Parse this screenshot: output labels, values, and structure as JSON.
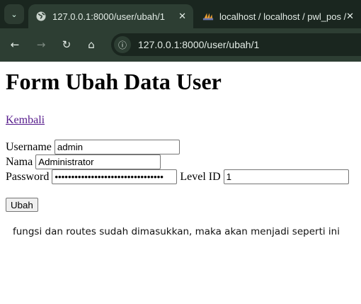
{
  "browser": {
    "tabs": [
      {
        "title": "127.0.0.1:8000/user/ubah/1",
        "icon": "globe-icon",
        "active": true
      },
      {
        "title": "localhost / localhost / pwl_pos /",
        "icon": "phpmyadmin-icon",
        "active": false
      }
    ],
    "url": "127.0.0.1:8000/user/ubah/1"
  },
  "page": {
    "title": "Form Ubah Data User",
    "back_link": "Kembali",
    "form": {
      "username_label": "Username",
      "username_value": "admin",
      "nama_label": "Nama",
      "nama_value": "Administrator",
      "password_label": "Password",
      "password_value": "•••••••••••••••••••••••••••••••••",
      "level_label": "Level ID",
      "level_value": "1",
      "submit": "Ubah"
    },
    "note": "fungsi dan routes sudah dimasukkan, maka akan menjadi seperti ini"
  }
}
